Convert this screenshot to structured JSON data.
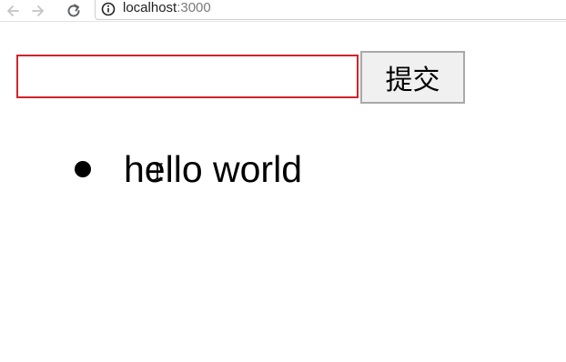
{
  "browser": {
    "url_host": "localhost",
    "url_port": ":3000",
    "icons": {
      "back": "back-arrow-icon",
      "forward": "forward-arrow-icon",
      "reload": "reload-icon",
      "info": "info-icon"
    }
  },
  "form": {
    "input_value": "",
    "input_placeholder": "",
    "submit_label": "提交"
  },
  "todos": [
    {
      "text": "hello world"
    }
  ],
  "colors": {
    "input_border": "#d2232a",
    "button_border": "#a9a9a9",
    "button_bg": "#f0f0f0"
  }
}
